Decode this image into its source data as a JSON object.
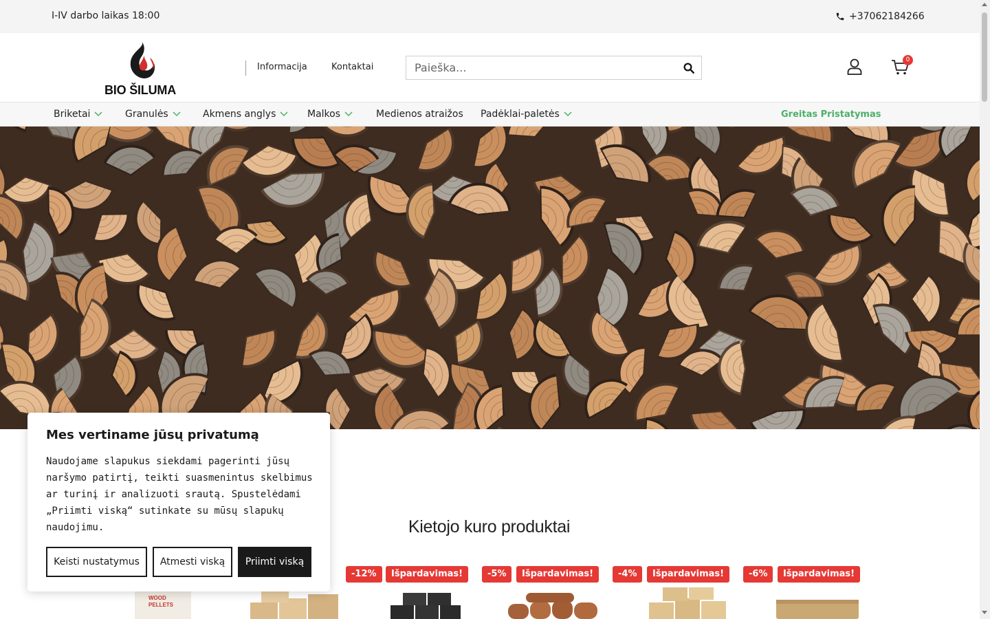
{
  "topbar": {
    "hours": "I-IV darbo laikas 18:00",
    "phone": "+37062184266"
  },
  "header": {
    "logo_text": "BIO ŠILUMA",
    "nav": [
      "Informacija",
      "Kontaktai"
    ],
    "search_placeholder": "Paieška...",
    "cart_count": "0"
  },
  "catnav": {
    "items": [
      {
        "label": "Briketai",
        "dropdown": true
      },
      {
        "label": "Granulės",
        "dropdown": true
      },
      {
        "label": "Akmens anglys",
        "dropdown": true
      },
      {
        "label": "Malkos",
        "dropdown": true
      },
      {
        "label": "Medienos atraižos",
        "dropdown": false
      },
      {
        "label": "Padėklai-paletės",
        "dropdown": true
      }
    ],
    "express": "Greitas Pristatymas"
  },
  "section": {
    "title": "Kietojo kuro produktai"
  },
  "products": [
    {
      "discount": "",
      "sale": "",
      "image": "wood-pellets-bag"
    },
    {
      "discount": "",
      "sale": "",
      "image": "briquettes-stack"
    },
    {
      "discount": "-12%",
      "sale": "Išpardavimas!",
      "image": "black-briquettes"
    },
    {
      "discount": "-5%",
      "sale": "Išpardavimas!",
      "image": "round-briquettes"
    },
    {
      "discount": "-4%",
      "sale": "Išpardavimas!",
      "image": "ruf-briquettes"
    },
    {
      "discount": "-6%",
      "sale": "Išpardavimas!",
      "image": "ruf-block"
    }
  ],
  "cookie": {
    "title": "Mes vertiname jūsų privatumą",
    "text": "Naudojame slapukus siekdami pagerinti jūsų naršymo patirtį, teikti suasmenintus skelbimus ar turinį ir analizuoti srautą. Spustelėdami „Priimti viską“ sutinkate su mūsų slapukų naudojimu.",
    "customize": "Keisti nustatymus",
    "reject": "Atmesti viską",
    "accept": "Priimti viską"
  },
  "colors": {
    "sale_red": "#e53935",
    "express_green": "#4caf6a",
    "dark": "#1a1a1a"
  }
}
